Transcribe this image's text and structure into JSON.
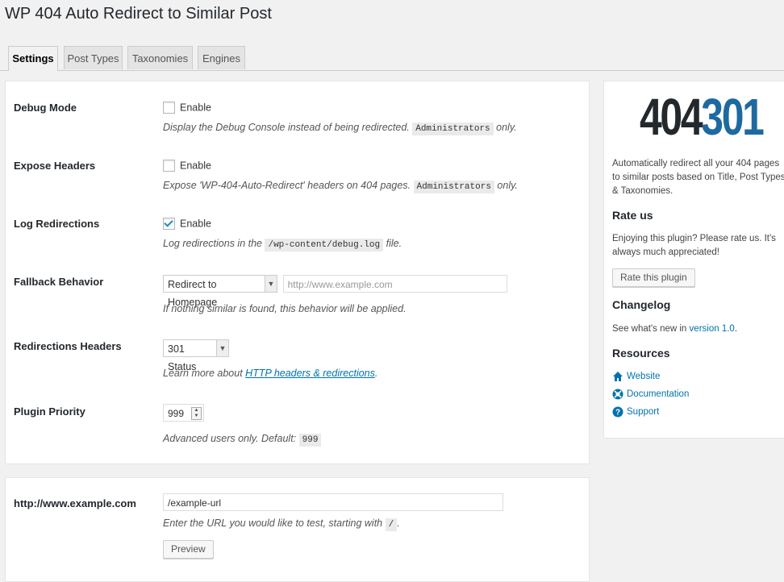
{
  "page": {
    "title": "WP 404 Auto Redirect to Similar Post"
  },
  "tabs": [
    {
      "label": "Settings",
      "active": true
    },
    {
      "label": "Post Types",
      "active": false
    },
    {
      "label": "Taxonomies",
      "active": false
    },
    {
      "label": "Engines",
      "active": false
    }
  ],
  "settings": {
    "debug": {
      "label": "Debug Mode",
      "checkbox_label": "Enable",
      "checked": false,
      "desc_before": "Display the Debug Console instead of being redirected.",
      "desc_code": "Administrators",
      "desc_after": "only."
    },
    "expose": {
      "label": "Expose Headers",
      "checkbox_label": "Enable",
      "checked": false,
      "desc_before": "Expose 'WP-404-Auto-Redirect' headers on 404 pages.",
      "desc_code": "Administrators",
      "desc_after": "only."
    },
    "log": {
      "label": "Log Redirections",
      "checkbox_label": "Enable",
      "checked": true,
      "desc_before": "Log redirections in the",
      "desc_code": "/wp-content/debug.log",
      "desc_after": "file."
    },
    "fallback": {
      "label": "Fallback Behavior",
      "select_value": "Redirect to Homepage",
      "url_placeholder": "http://www.example.com",
      "desc": "If nothing similar is found, this behavior will be applied."
    },
    "headers": {
      "label": "Redirections Headers",
      "select_value": "301 Status",
      "desc_before": "Learn more about",
      "desc_link": "HTTP headers & redirections",
      "desc_after": "."
    },
    "priority": {
      "label": "Plugin Priority",
      "value": "999",
      "desc_before": "Advanced users only. Default:",
      "desc_code": "999"
    }
  },
  "tester": {
    "label": "http://www.example.com",
    "input_value": "/example-url",
    "desc_before": "Enter the URL you would like to test, starting with",
    "desc_code": "/",
    "desc_after": ".",
    "button": "Preview"
  },
  "sidebar": {
    "logo_left": "404",
    "logo_right": "301",
    "logo_colors": {
      "left": "#23282d",
      "right": "#1e6aa0"
    },
    "intro": "Automatically redirect all your 404 pages to similar posts based on Title, Post Types & Taxonomies.",
    "rate": {
      "heading": "Rate us",
      "text": "Enjoying this plugin? Please rate us. It's always much appreciated!",
      "button": "Rate this plugin"
    },
    "changelog": {
      "heading": "Changelog",
      "text_before": "See what's new in",
      "link": "version 1.0",
      "text_after": "."
    },
    "resources": {
      "heading": "Resources",
      "items": [
        {
          "label": "Website",
          "icon": "home-icon"
        },
        {
          "label": "Documentation",
          "icon": "lifebuoy-icon"
        },
        {
          "label": "Support",
          "icon": "help-icon"
        }
      ]
    }
  }
}
